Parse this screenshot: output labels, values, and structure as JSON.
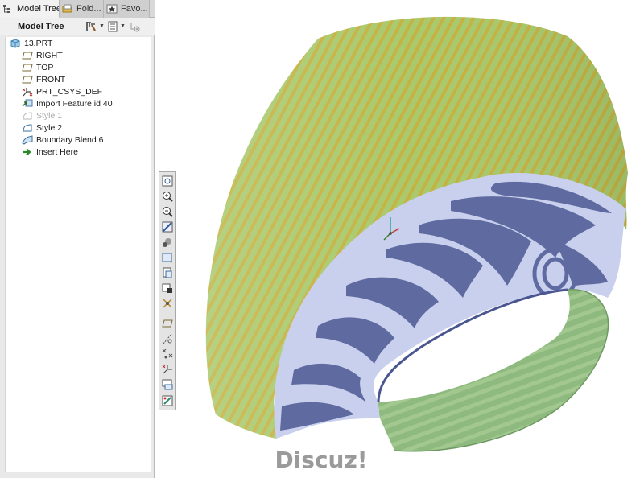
{
  "tabs": [
    {
      "label": "Model Tree",
      "icon": "model-tree-icon",
      "active": true
    },
    {
      "label": "Fold...",
      "icon": "folder-icon",
      "active": false
    },
    {
      "label": "Favo...",
      "icon": "favorites-icon",
      "active": false
    }
  ],
  "tree_toolbar": {
    "header": "Model Tree",
    "settings_icon": "tree-settings-icon",
    "columns_icon": "tree-columns-icon",
    "filter_icon": "tree-filter-icon"
  },
  "tree": {
    "items": [
      {
        "label": "13.PRT",
        "icon": "part-icon",
        "dim": false
      },
      {
        "label": "RIGHT",
        "icon": "datum-plane-icon",
        "dim": false
      },
      {
        "label": "TOP",
        "icon": "datum-plane-icon",
        "dim": false
      },
      {
        "label": "FRONT",
        "icon": "datum-plane-icon",
        "dim": false
      },
      {
        "label": "PRT_CSYS_DEF",
        "icon": "csys-icon",
        "dim": false
      },
      {
        "label": "Import Feature id 40",
        "icon": "import-feature-icon",
        "dim": false
      },
      {
        "label": "Style 1",
        "icon": "style-icon",
        "dim": true
      },
      {
        "label": "Style 2",
        "icon": "style-icon",
        "dim": false
      },
      {
        "label": "Boundary Blend 6",
        "icon": "boundary-blend-icon",
        "dim": false
      },
      {
        "label": "Insert Here",
        "icon": "insert-here-arrow-icon",
        "dim": false
      }
    ]
  },
  "view_toolbar": [
    "zoom-fit-icon",
    "zoom-in-icon",
    "zoom-out-icon",
    "repaint-icon",
    "display-style-icon",
    "saved-views-icon",
    "view-manager-icon",
    "perspective-icon",
    "spin-center-icon",
    "datum-planes-icon",
    "datum-axes-icon",
    "datum-points-icon",
    "csys-display-icon",
    "annotation-display-icon",
    "appearance-icon"
  ],
  "viewport": {
    "model_icon": "3d-model-surface-icon",
    "colors": {
      "green_surface": "#a8c96a",
      "stripe": "#c6b33d",
      "blue_band": "#5e6a9f",
      "light_band": "#c9d0ee",
      "ring": "#8fb981"
    }
  },
  "watermark": "Discuz!"
}
